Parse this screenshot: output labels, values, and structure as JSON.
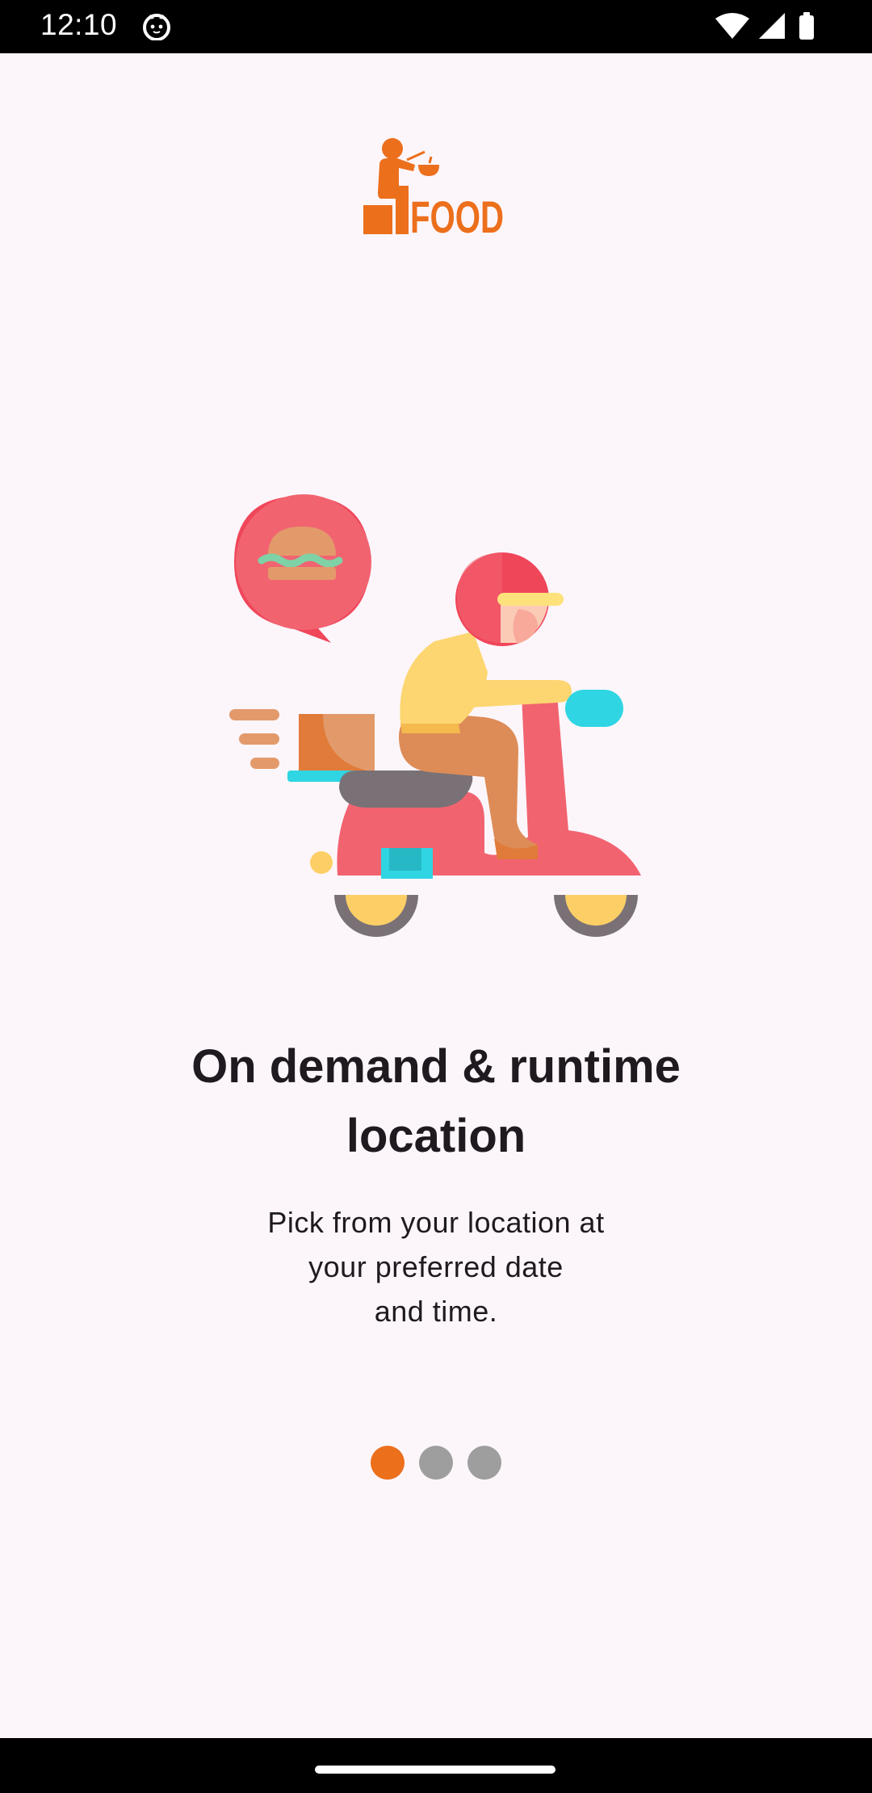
{
  "status_bar": {
    "time": "12:10",
    "icons": [
      "cat-notification-icon",
      "wifi-icon",
      "cellular-signal-icon",
      "battery-icon"
    ]
  },
  "logo": {
    "text": "FOOD",
    "color": "#ec6f1c"
  },
  "illustration": {
    "icon": "delivery-scooter-illustration"
  },
  "onboarding": {
    "title": "On demand & runtime\nlocation",
    "subtitle": "Pick from your location at\nyour preferred date\nand time."
  },
  "pager": {
    "total_pages": 3,
    "active_page": 1,
    "active_color": "#ec6f1c",
    "inactive_color": "#9e9e9e"
  },
  "colors": {
    "background": "#fcf6fb",
    "text": "#1f1a1f"
  }
}
